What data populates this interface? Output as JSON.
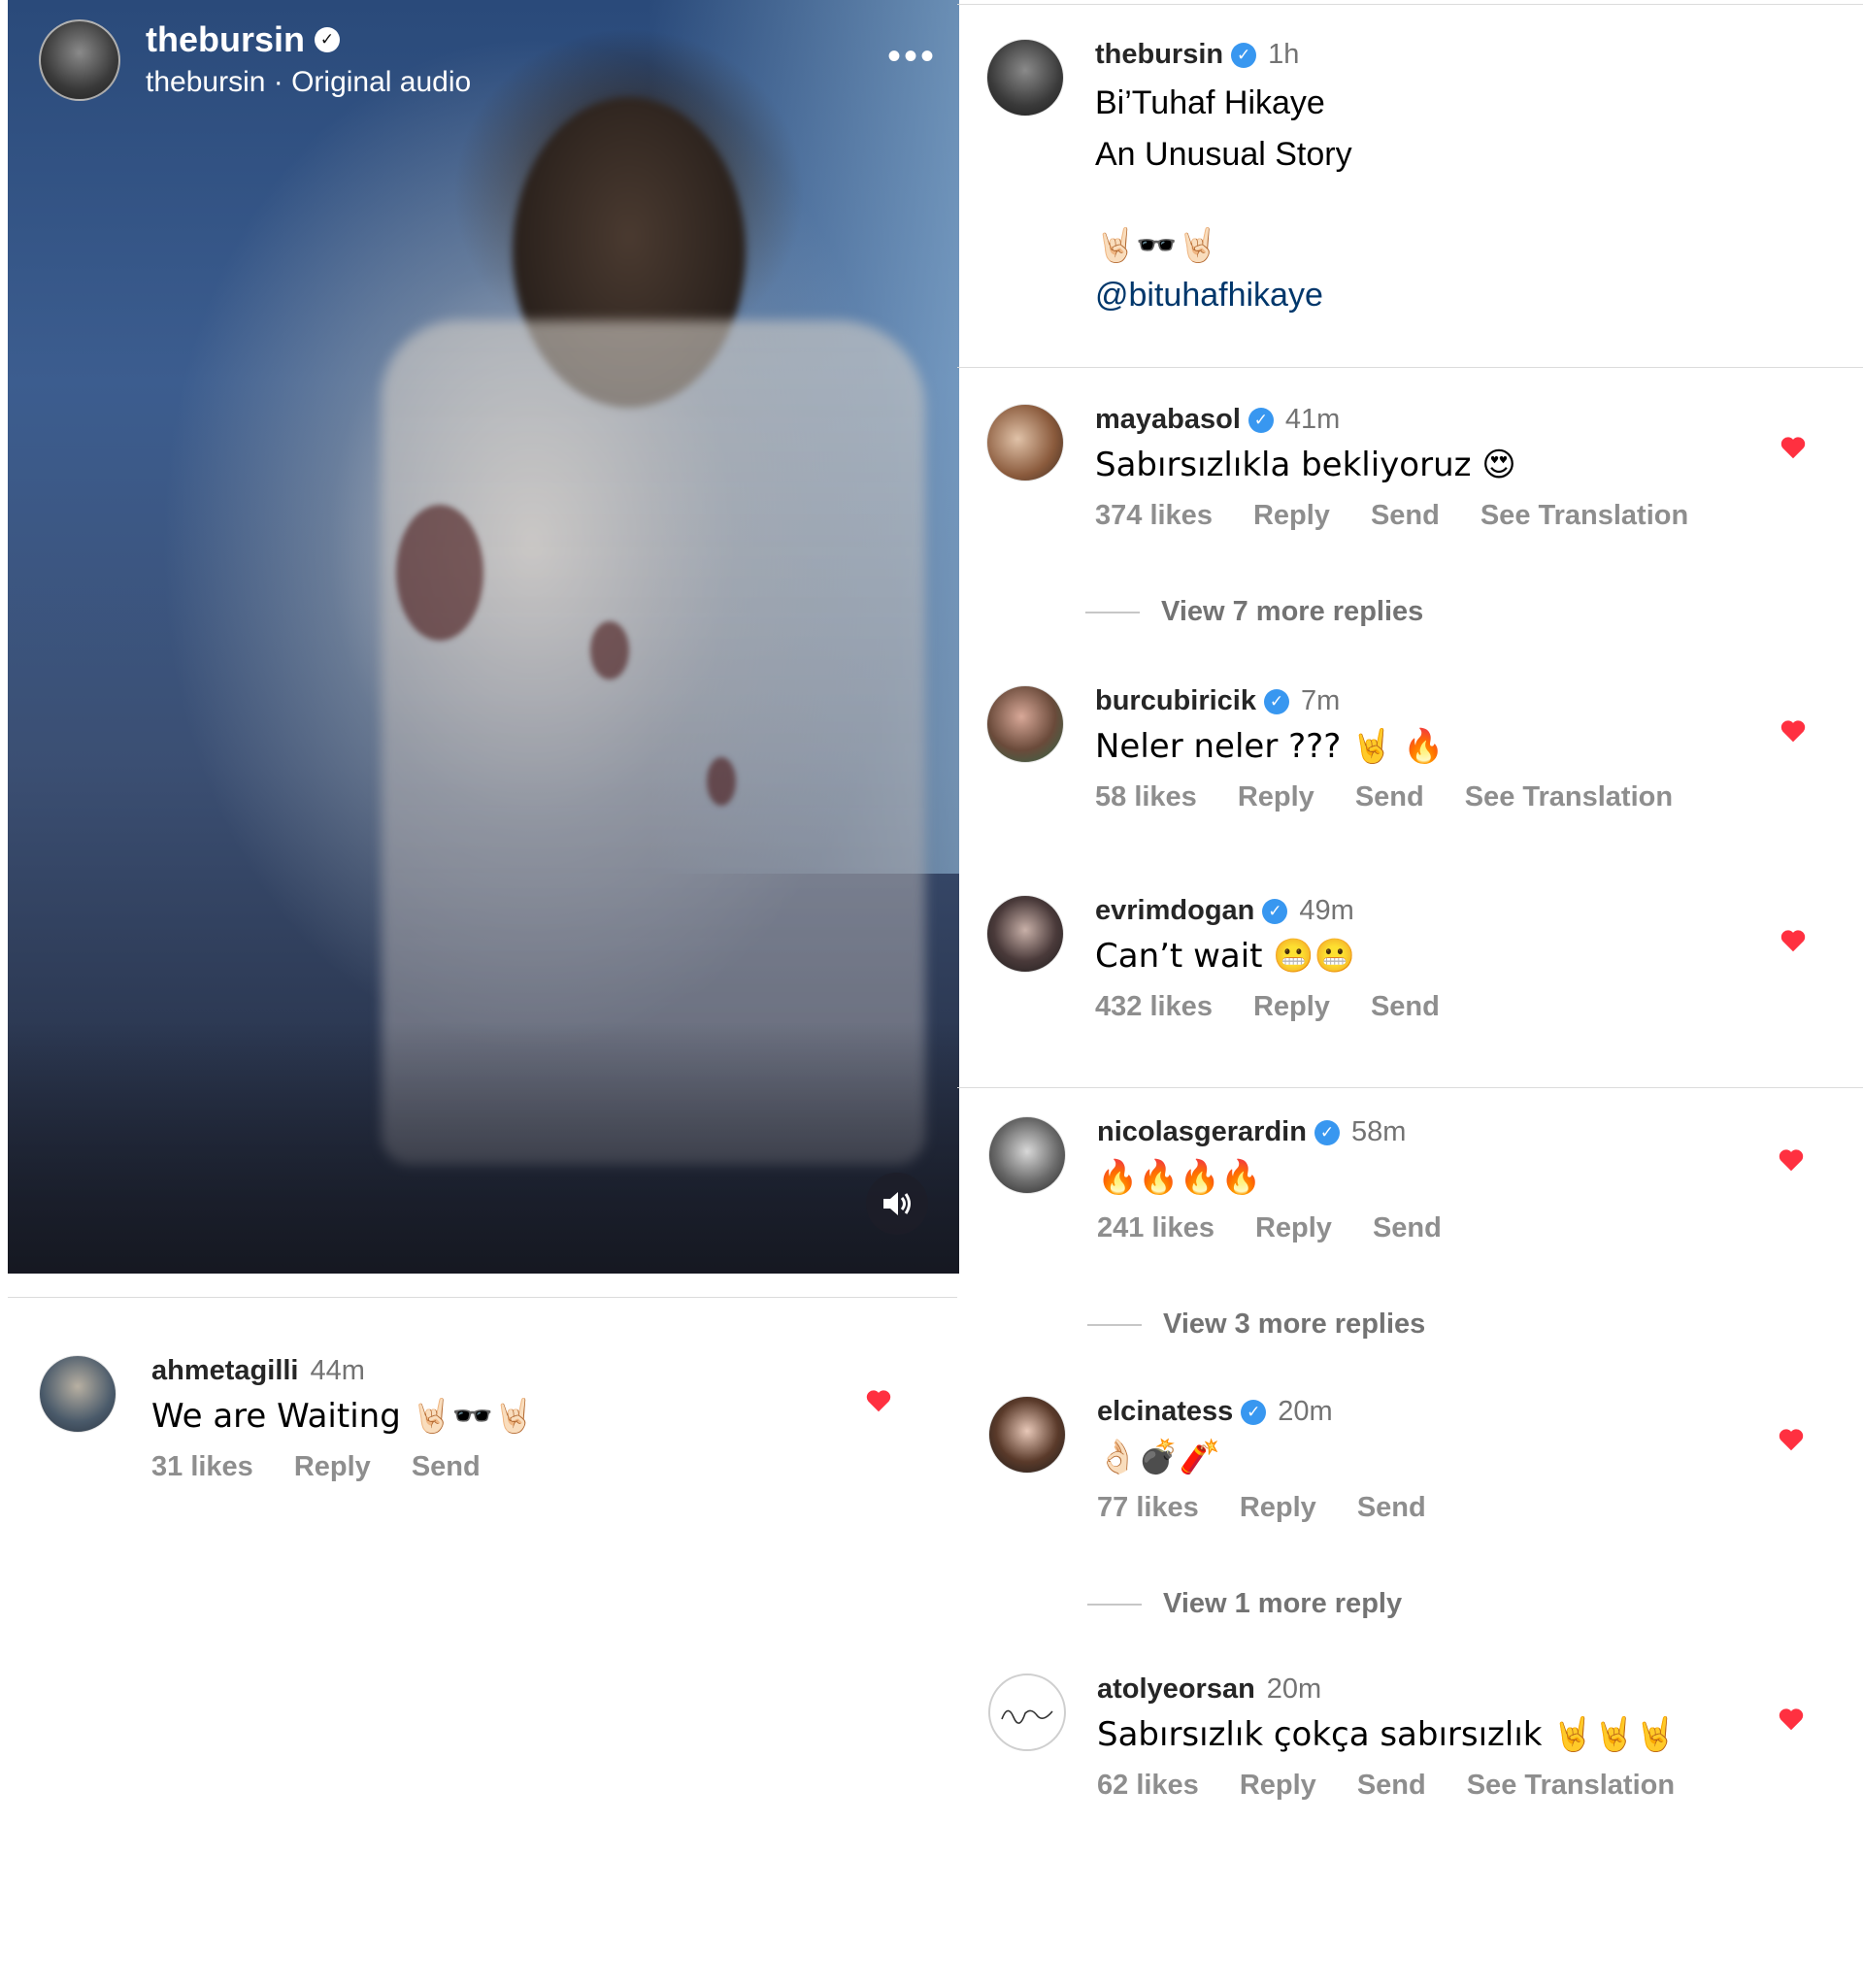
{
  "post": {
    "username": "thebursin",
    "subtitle": "thebursin · Original audio",
    "more_icon": "more-horizontal-icon",
    "audio_icon": "speaker-icon"
  },
  "caption": {
    "username": "thebursin",
    "time": "1h",
    "line1": "Bi’Tuhaf Hikaye",
    "line2": "An Unusual Story",
    "emojis": "🤘🏻🕶️🤘🏻",
    "mention": "@bituhafhikaye"
  },
  "left_comment": {
    "username": "ahmetagilli",
    "time": "44m",
    "text": "We are Waiting 🤘🏻🕶️🤘🏻",
    "likes": "31 likes",
    "reply": "Reply",
    "send": "Send"
  },
  "comments": [
    {
      "username": "mayabasol",
      "time": "41m",
      "text": "Sabırsızlıkla bekliyoruz 😍",
      "likes": "374 likes",
      "reply": "Reply",
      "send": "Send",
      "translate": "See Translation",
      "view_more": "View 7 more replies"
    },
    {
      "username": "burcubiricik",
      "time": "7m",
      "text": "Neler neler ??? 🤘 🔥",
      "likes": "58 likes",
      "reply": "Reply",
      "send": "Send",
      "translate": "See Translation"
    },
    {
      "username": "evrimdogan",
      "time": "49m",
      "text": "Can’t wait 😬😬",
      "likes": "432 likes",
      "reply": "Reply",
      "send": "Send"
    },
    {
      "username": "nicolasgerardin",
      "time": "58m",
      "text": "🔥🔥🔥🔥",
      "likes": "241 likes",
      "reply": "Reply",
      "send": "Send",
      "view_more": "View 3 more replies"
    },
    {
      "username": "elcinatess",
      "time": "20m",
      "text": "👌🏻💣🧨",
      "likes": "77 likes",
      "reply": "Reply",
      "send": "Send",
      "view_more": "View 1 more reply"
    },
    {
      "username": "atolyeorsan",
      "time": "20m",
      "text": "Sabırsızlık çokça sabırsızlık 🤘🤘🤘",
      "likes": "62 likes",
      "reply": "Reply",
      "send": "Send",
      "translate": "See Translation"
    }
  ],
  "colors": {
    "heart": "#ff3040",
    "verified": "#3897f0",
    "link": "#00376b"
  }
}
